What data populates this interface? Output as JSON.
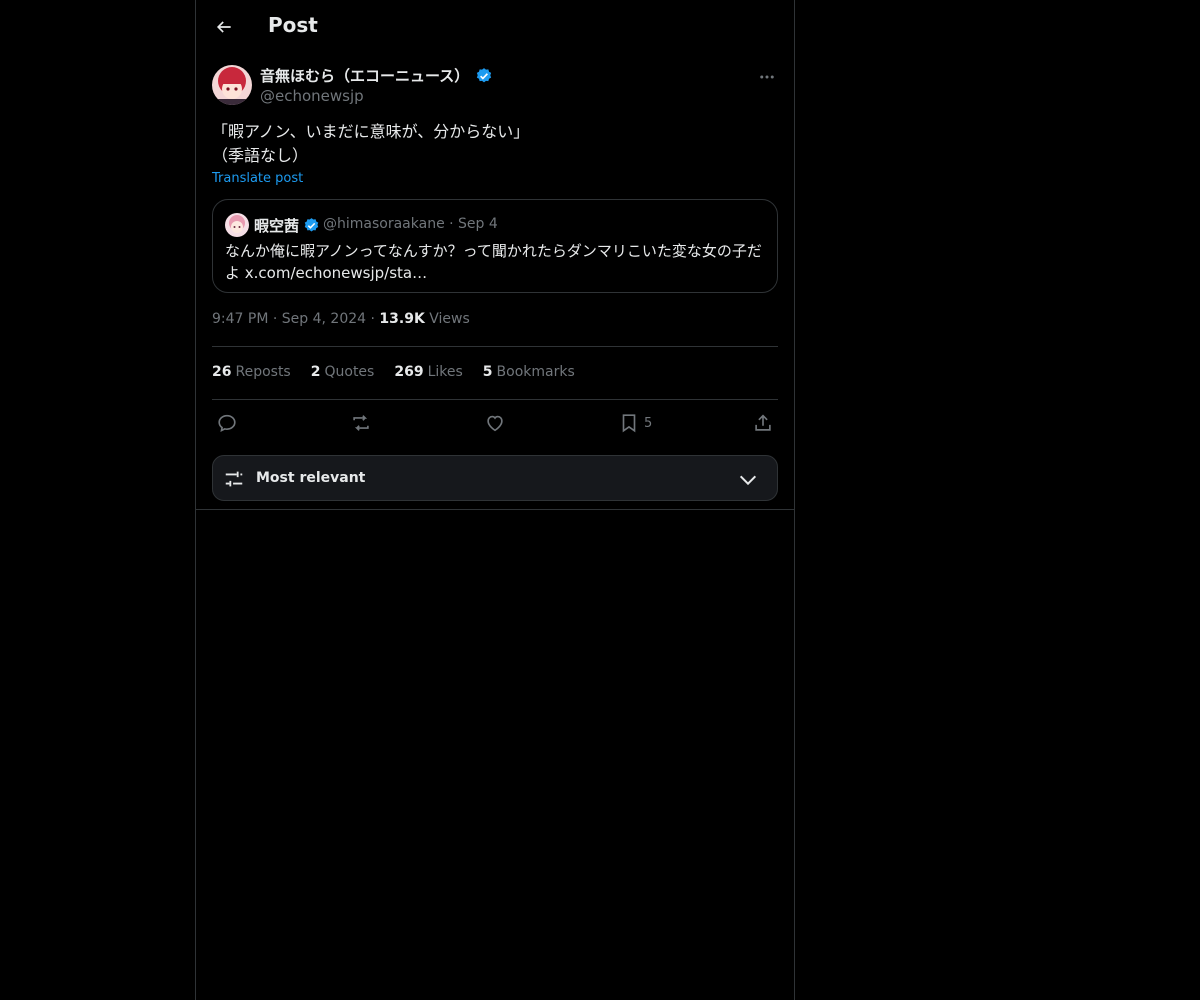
{
  "header": {
    "title": "Post"
  },
  "post": {
    "author_name": "音無ほむら（エコーニュース）",
    "handle": "@echonewsjp",
    "text": "「暇アノン、いまだに意味が、分からない」\n（季語なし）",
    "translate_label": "Translate post"
  },
  "quote": {
    "author_name": "暇空茜",
    "handle": "@himasoraakane",
    "date": "Sep 4",
    "text": "なんか俺に暇アノンってなんすか？って聞かれたらダンマリこいた変な女の子だよ x.com/echonewsjp/sta…"
  },
  "meta": {
    "time": "9:47 PM",
    "date": "Sep 4, 2024",
    "views_count": "13.9K",
    "views_label": "Views"
  },
  "stats": {
    "reposts_count": "26",
    "reposts_label": "Reposts",
    "quotes_count": "2",
    "quotes_label": "Quotes",
    "likes_count": "269",
    "likes_label": "Likes",
    "bookmarks_count": "5",
    "bookmarks_label": "Bookmarks"
  },
  "actions": {
    "bookmark_count": "5",
    "icons": [
      "reply-icon",
      "repost-icon",
      "like-icon",
      "bookmark-icon",
      "share-icon"
    ]
  },
  "sort": {
    "label": "Most relevant"
  },
  "colors": {
    "accent": "#1d9bf0",
    "background": "#000000",
    "border": "#2f3336",
    "muted": "#71767b",
    "text": "#e7e9ea"
  }
}
